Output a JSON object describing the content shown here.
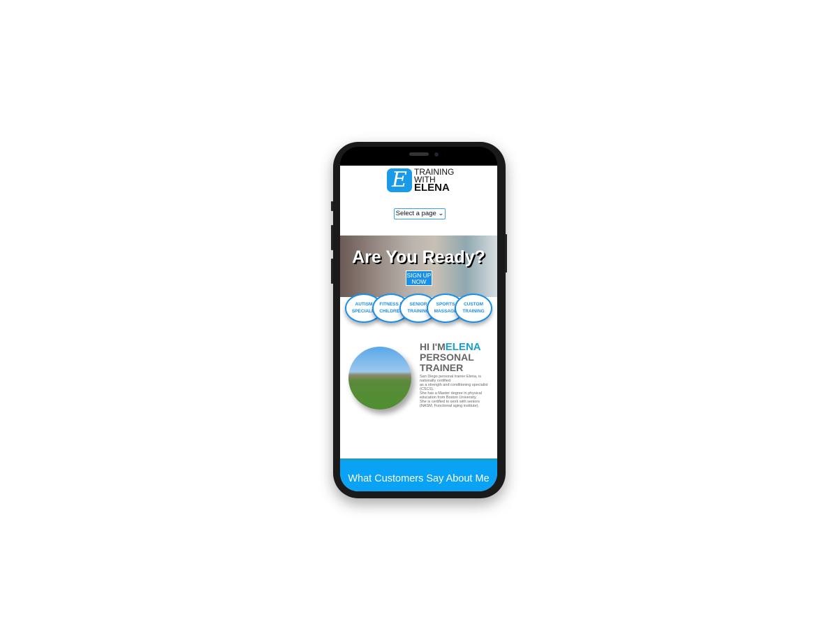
{
  "logo": {
    "letter": "E",
    "line1": "TRAINING",
    "line2": "WITH",
    "line3": "ELENA"
  },
  "nav": {
    "select_value": "Select a page ⌄"
  },
  "hero": {
    "title": "Are You Ready?",
    "signup": "SIGN UP\nNOW"
  },
  "services": [
    {
      "label": "AUTISM\nSPECIALIS"
    },
    {
      "label": "FITNESS F\nCHILDREN"
    },
    {
      "label": "SENIOR\nTRAINING"
    },
    {
      "label": "SPORTS\nMASSAGE"
    },
    {
      "label": "CUSTOM\nTRAINING"
    }
  ],
  "about": {
    "hi": "HI I'M",
    "name": "ELENA",
    "role1": "PERSONAL",
    "role2": "TRAINER",
    "bio": "San Diego personal trainer Elena, is nationally certified\nas a strength and conditioning specialist (CSCS).\nShe has a Master degree in physical education from Boston University.\nShe is certified to work with seniors (NASM, Functional aging institute)."
  },
  "footer": {
    "title": "What Customers Say About Me"
  }
}
